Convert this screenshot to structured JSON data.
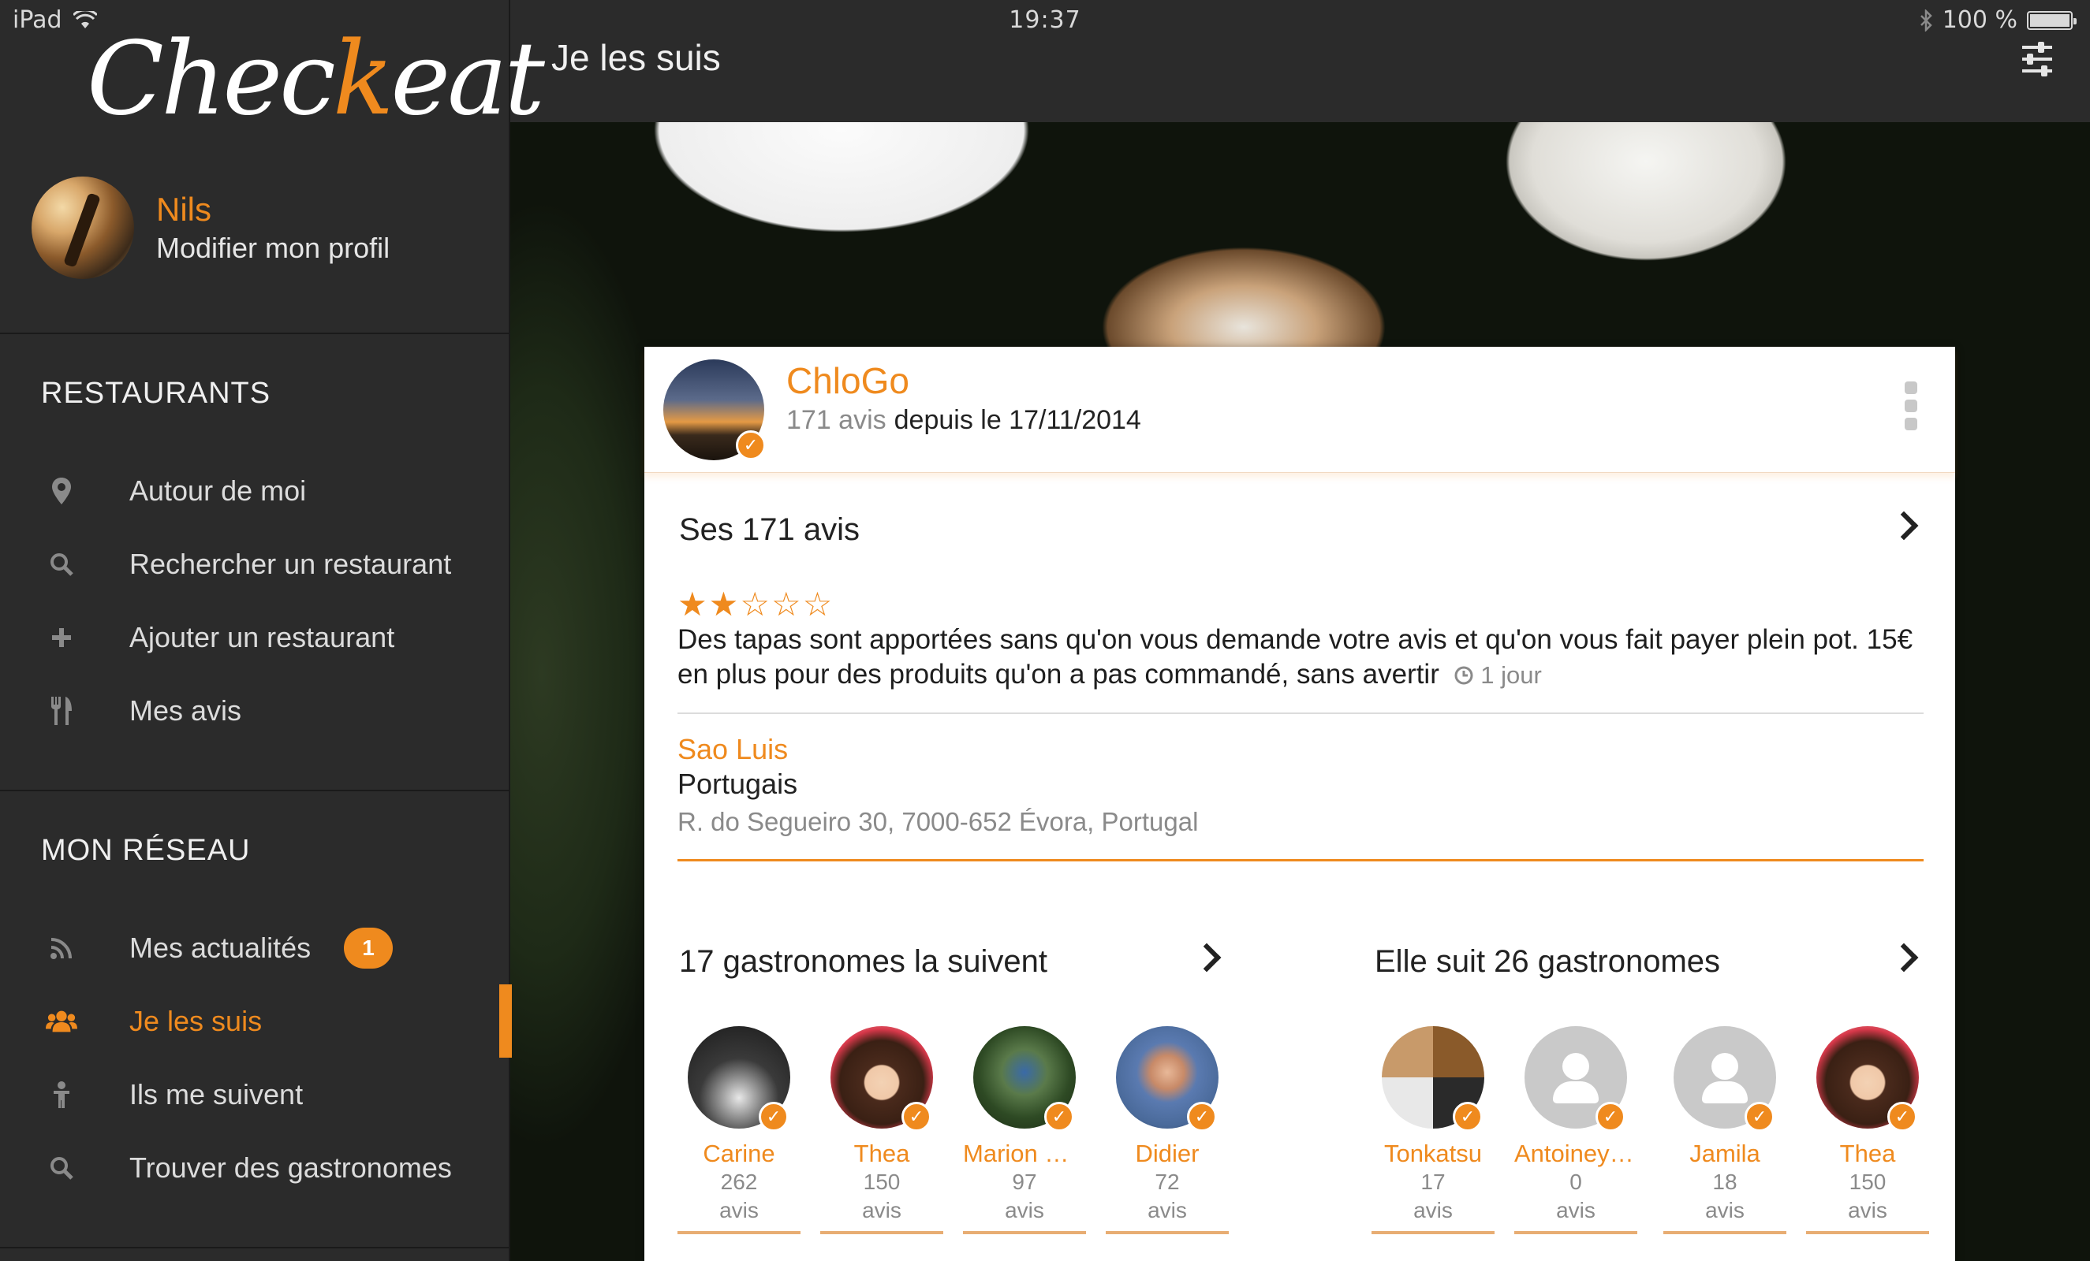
{
  "status_bar": {
    "device": "iPad",
    "time": "19:37",
    "battery": "100 %"
  },
  "sidebar": {
    "logo": {
      "before": "Chec",
      "accent": "k",
      "after": "eat"
    },
    "profile": {
      "name": "Nils",
      "edit_label": "Modifier mon profil"
    },
    "restaurants_heading": "RESTAURANTS",
    "restaurants_items": [
      {
        "label": "Autour de moi",
        "icon": "map-pin-icon"
      },
      {
        "label": "Rechercher un restaurant",
        "icon": "search-icon"
      },
      {
        "label": "Ajouter un restaurant",
        "icon": "plus-icon"
      },
      {
        "label": "Mes avis",
        "icon": "cutlery-icon"
      }
    ],
    "network_heading": "MON RÉSEAU",
    "network_items": [
      {
        "label": "Mes actualités",
        "icon": "rss-icon",
        "badge": "1"
      },
      {
        "label": "Je les suis",
        "icon": "group-icon",
        "active": true
      },
      {
        "label": "Ils me suivent",
        "icon": "person-icon"
      },
      {
        "label": "Trouver des gastronomes",
        "icon": "search-icon"
      }
    ]
  },
  "topbar": {
    "title": "Je les suis",
    "filter_icon": "sliders-icon"
  },
  "colors": {
    "accent": "#ef8a1e",
    "sidebar_bg": "#2b2b2b"
  },
  "user": {
    "name": "ChloGo",
    "reviews": "171 avis",
    "since": "depuis le 17/11/2014"
  },
  "reviews_section": {
    "title": "Ses 171 avis",
    "rating": 2,
    "rating_max": 5,
    "text": "Des tapas sont apportées sans qu'on vous demande votre avis et qu'on vous fait payer plein pot. 15€ en plus pour des produits qu'on a pas commandé, sans avertir",
    "time_ago": "1 jour",
    "restaurant_name": "Sao Luis",
    "restaurant_type": "Portugais",
    "restaurant_address": "R. do Segueiro 30, 7000-652 Évora, Portugal"
  },
  "followers": {
    "title": "17 gastronomes la suivent",
    "people": [
      {
        "name": "Carine",
        "count": "262",
        "label": "avis"
      },
      {
        "name": "Thea",
        "count": "150",
        "label": "avis"
      },
      {
        "name": "Marion Nav",
        "count": "97",
        "label": "avis"
      },
      {
        "name": "Didier",
        "count": "72",
        "label": "avis"
      }
    ]
  },
  "following": {
    "title": "Elle suit 26 gastronomes",
    "people": [
      {
        "name": "Tonkatsu",
        "count": "17",
        "label": "avis"
      },
      {
        "name": "Antoineyos...",
        "count": "0",
        "label": "avis"
      },
      {
        "name": "Jamila",
        "count": "18",
        "label": "avis"
      },
      {
        "name": "Thea",
        "count": "150",
        "label": "avis"
      }
    ]
  }
}
